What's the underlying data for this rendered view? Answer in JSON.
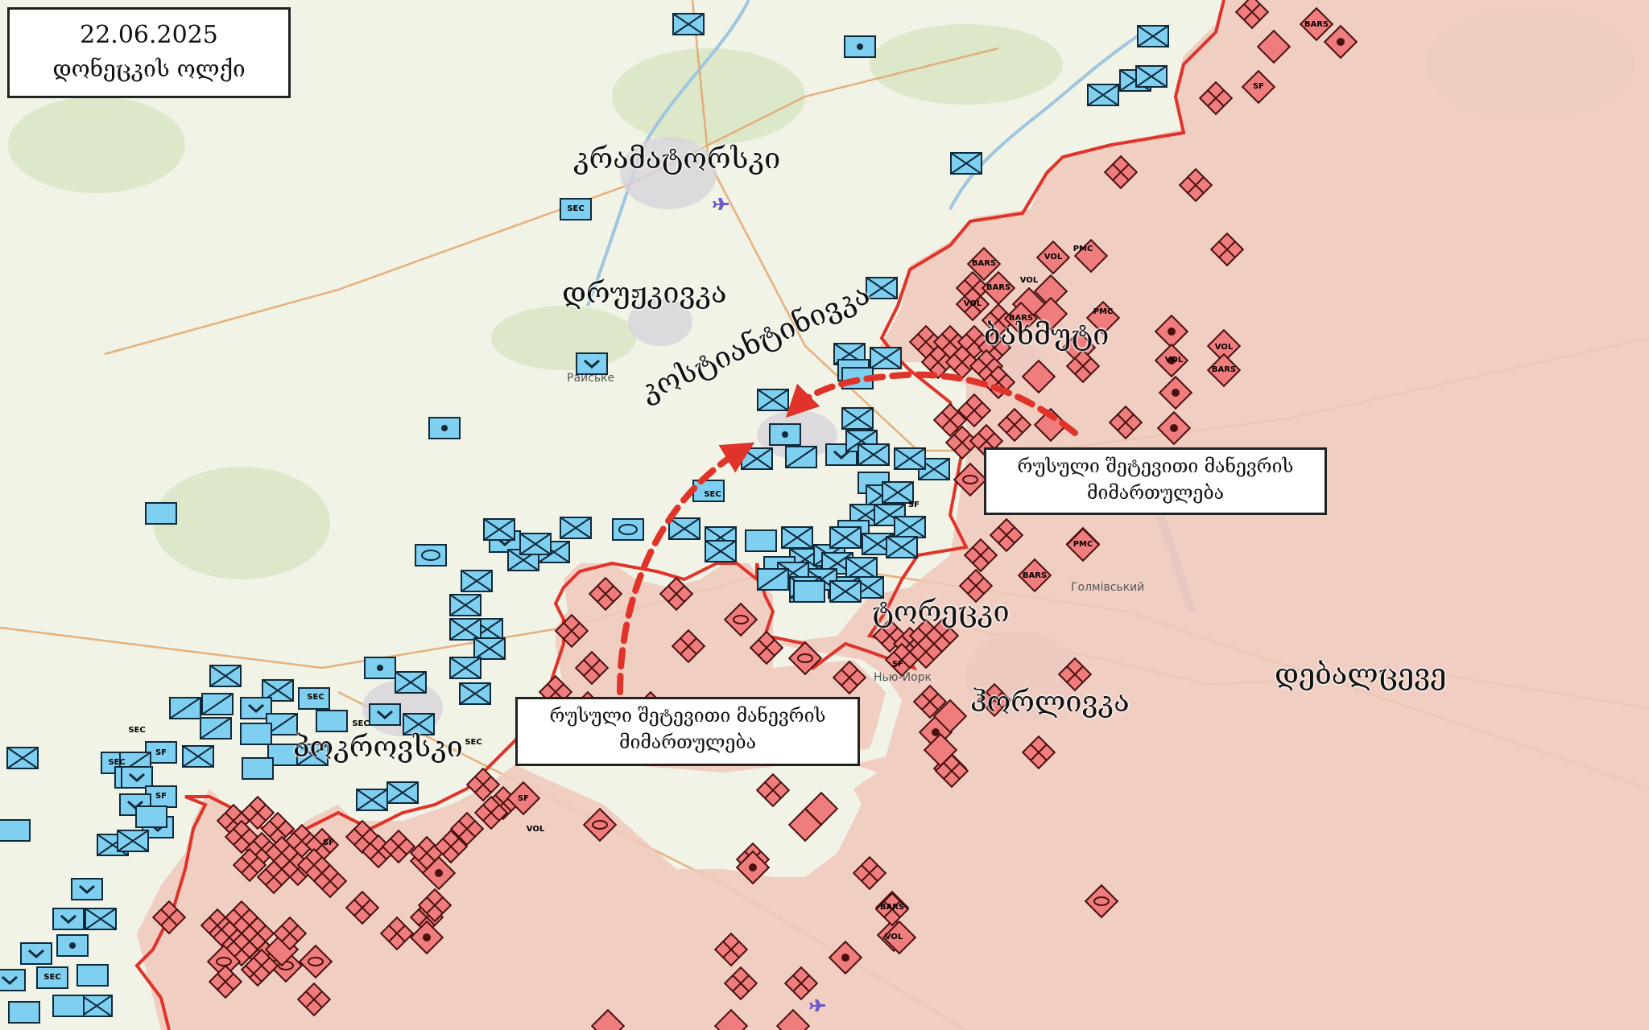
{
  "header": {
    "date": "22.06.2025",
    "region": "დონეცკის ოლქი"
  },
  "callouts": [
    {
      "text_line1": "რუსული შეტევითი მანევრის",
      "text_line2": "მიმართულება"
    },
    {
      "text_line1": "რუსული შეტევითი მანევრის",
      "text_line2": "მიმართულება"
    }
  ],
  "cities": {
    "kramatorsk": "კრამატორსკი",
    "druzhkivka": "დრუჟკივკა",
    "kostiantynivka": "კოსტიანტინივკა",
    "bakhmut": "ბახმუტი",
    "toretsk": "ტორეცკი",
    "horlivka": "ჰორლივკა",
    "pokrovsk": "პოკროვსკი",
    "debaltseve": "დებალცევე"
  },
  "map_labels": {
    "raiske": "Райське",
    "holmivskyi": "Голмівський",
    "niu_york": "Нью-Йорк"
  },
  "unit_marks": {
    "sec": "SEC",
    "sf": "SF",
    "vol": "VOL",
    "bars": "BARS",
    "pmc": "PMC"
  },
  "colors": {
    "ukrainian_units": "#7fcff0",
    "russian_units": "#f07d7d",
    "occupied_area": "#efc8bd",
    "front_line": "#e0332a",
    "map_base": "#f1f3e6"
  },
  "legend_icons": [
    "infantry-icon",
    "mechanized-icon",
    "artillery-icon",
    "airport-icon"
  ]
}
